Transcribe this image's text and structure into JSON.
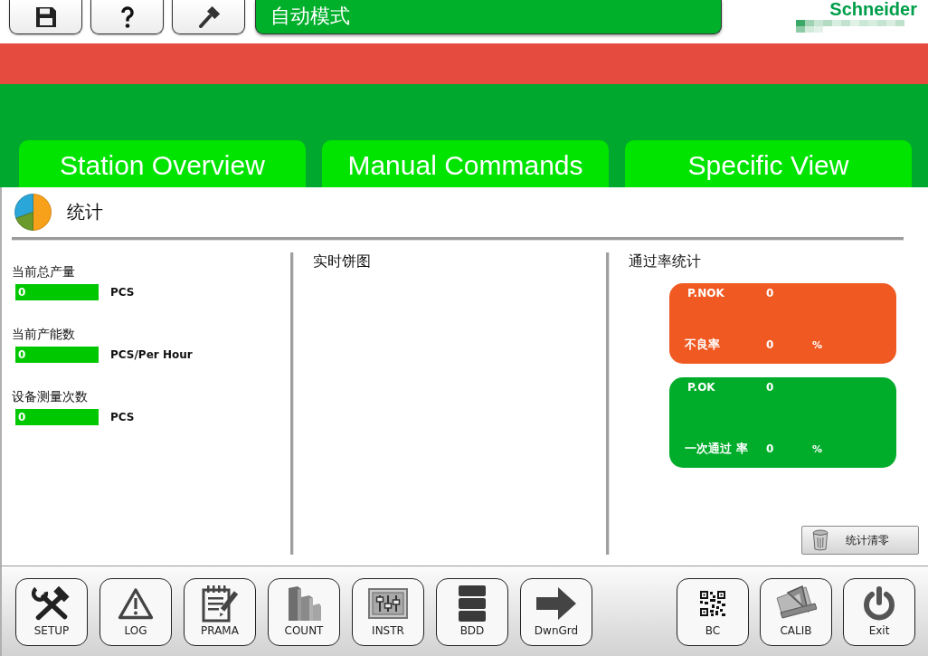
{
  "mode_banner": {
    "text": "自动模式"
  },
  "logo": {
    "text": "Schneider"
  },
  "tabs": [
    {
      "label": "Station Overview",
      "selected": false
    },
    {
      "label": "Manual Commands",
      "selected": false
    },
    {
      "label": "Specific View",
      "selected": false
    }
  ],
  "section": {
    "title": "统计"
  },
  "counters": [
    {
      "label": "当前总产量",
      "value": "0",
      "unit": "PCS"
    },
    {
      "label": "当前产能数",
      "value": "0",
      "unit": "PCS/Per Hour"
    },
    {
      "label": "设备测量次数",
      "value": "0",
      "unit": "PCS"
    }
  ],
  "pie_panel": {
    "title": "实时饼图"
  },
  "pass_rate": {
    "title": "通过率统计",
    "cards": [
      {
        "color": "#f05a22",
        "count_label": "P.NOK",
        "count": "0",
        "rate_label": "不良率",
        "rate": "0",
        "unit": "%"
      },
      {
        "color": "#00ad2b",
        "count_label": "P.OK",
        "count": "0",
        "rate_label": "一次通过 率",
        "rate": "0",
        "unit": "%"
      }
    ]
  },
  "clear_button": {
    "label": "统计清零"
  },
  "toolbar": {
    "left_buttons": [
      {
        "label": "SETUP"
      },
      {
        "label": "LOG"
      },
      {
        "label": "PRAMA"
      },
      {
        "label": "COUNT"
      },
      {
        "label": "INSTR"
      },
      {
        "label": "BDD"
      },
      {
        "label": "DwnGrd"
      }
    ],
    "right_buttons": [
      {
        "label": "BC"
      },
      {
        "label": "CALIB"
      },
      {
        "label": "Exit"
      }
    ]
  }
}
